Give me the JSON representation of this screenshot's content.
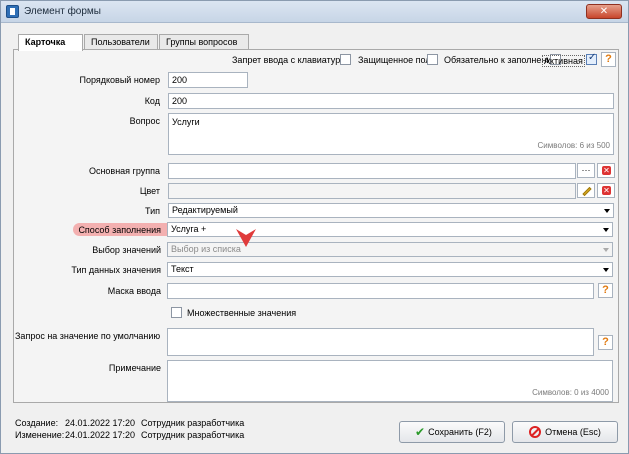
{
  "window": {
    "title": "Элемент формы",
    "close_label": "✕"
  },
  "tabs": [
    {
      "label": "Карточка"
    },
    {
      "label": "Пользователи"
    },
    {
      "label": "Группы вопросов"
    }
  ],
  "flags": {
    "no_keyboard": {
      "label": "Запрет ввода с клавиатуры",
      "checked": false
    },
    "protected": {
      "label": "Защищенное поле",
      "checked": false
    },
    "required": {
      "label": "Обязательно к заполнению",
      "checked": false
    },
    "active": {
      "label": "Активная",
      "checked": true
    }
  },
  "fields": {
    "order": {
      "label": "Порядковый номер",
      "value": "200"
    },
    "code": {
      "label": "Код",
      "value": "200"
    },
    "question": {
      "label": "Вопрос",
      "value": "Услуги",
      "counter": "Символов: 6 из 500"
    },
    "main_group": {
      "label": "Основная группа",
      "value": ""
    },
    "color": {
      "label": "Цвет",
      "value": ""
    },
    "type": {
      "label": "Тип",
      "value": "Редактируемый"
    },
    "fill_method": {
      "label": "Способ заполнения",
      "value": "Услуга +"
    },
    "value_choice": {
      "label": "Выбор значений",
      "value": "Выбор из списка"
    },
    "data_type": {
      "label": "Тип данных значения",
      "value": "Текст"
    },
    "mask": {
      "label": "Маска ввода",
      "value": ""
    },
    "multiple": {
      "label": "Множественные значения",
      "checked": false
    },
    "default_query": {
      "label": "Запрос на значение по умолчанию",
      "value": ""
    },
    "note": {
      "label": "Примечание",
      "value": "",
      "counter": "Символов: 0 из 4000"
    }
  },
  "buttons": {
    "ellipsis": "···",
    "help": "?"
  },
  "footer": {
    "created_label": "Создание:",
    "created_date": "24.01.2022 17:20",
    "created_by": "Сотрудник разработчика",
    "modified_label": "Изменение:",
    "modified_date": "24.01.2022 17:20",
    "modified_by": "Сотрудник разработчика"
  },
  "actions": {
    "save": "Сохранить (F2)",
    "cancel": "Отмена (Esc)"
  },
  "colors": {
    "highlight": "#f39a9a",
    "arrow": "#e03b3b"
  }
}
